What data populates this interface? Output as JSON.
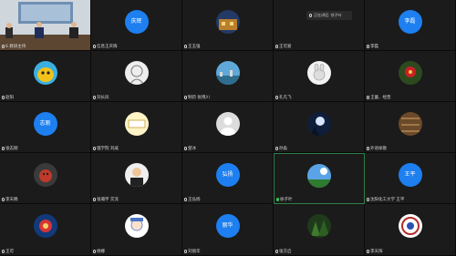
{
  "speaker_toast": {
    "text": "正在讲话: 徐子叶"
  },
  "tiles": [
    {
      "name": "6 教研主持",
      "avatar_text": "",
      "icon": "video-feed"
    },
    {
      "name": "信息王庆辉",
      "avatar_text": "庆辉",
      "icon": ""
    },
    {
      "name": "王玉强",
      "avatar_text": "",
      "icon": "building-photo-icon"
    },
    {
      "name": "王可爱",
      "avatar_text": "",
      "icon": ""
    },
    {
      "name": "李磊",
      "avatar_text": "李磊",
      "icon": ""
    },
    {
      "name": "赵阳",
      "avatar_text": "",
      "icon": "cartoon-yellow-icon"
    },
    {
      "name": "刘长凤",
      "avatar_text": "",
      "icon": "sketch-girl-icon"
    },
    {
      "name": "制药 张博川",
      "avatar_text": "",
      "icon": "landscape-icon"
    },
    {
      "name": "孔凡飞",
      "avatar_text": "",
      "icon": "bunny-icon"
    },
    {
      "name": "王蕾、经晋",
      "avatar_text": "",
      "icon": "red-flower-icon"
    },
    {
      "name": "张志刚",
      "avatar_text": "志刚",
      "icon": ""
    },
    {
      "name": "理学院 刘威",
      "avatar_text": "",
      "icon": "sign-board-icon"
    },
    {
      "name": "楚冰",
      "avatar_text": "",
      "icon": "default-user-icon"
    },
    {
      "name": "孙淼",
      "avatar_text": "",
      "icon": "moon-tree-icon"
    },
    {
      "name": "外语徐歌",
      "avatar_text": "",
      "icon": "bookshelf-icon"
    },
    {
      "name": "李天赐",
      "avatar_text": "",
      "icon": "dog-photo-icon"
    },
    {
      "name": "张瀚宇 交流",
      "avatar_text": "",
      "icon": "man-photo-icon"
    },
    {
      "name": "王弘扬",
      "avatar_text": "弘扬",
      "icon": ""
    },
    {
      "name": "徐子叶",
      "avatar_text": "",
      "icon": "sky-tree-icon"
    },
    {
      "name": "沈阳化工大学 王平",
      "avatar_text": "王平",
      "icon": ""
    },
    {
      "name": "王可",
      "avatar_text": "",
      "icon": "hero-photo-icon"
    },
    {
      "name": "杨娜",
      "avatar_text": "",
      "icon": "anime-girl-icon"
    },
    {
      "name": "刘丽华",
      "avatar_text": "丽华",
      "icon": ""
    },
    {
      "name": "张方启",
      "avatar_text": "",
      "icon": "forest-icon"
    },
    {
      "name": "李天阳",
      "avatar_text": "",
      "icon": "logo-badge-icon"
    }
  ],
  "active_tile": 18,
  "colors": {
    "avatar_blue": "#1d7ff0",
    "active_border": "#2e7d46",
    "tile_bg": "#1b1b1b"
  }
}
